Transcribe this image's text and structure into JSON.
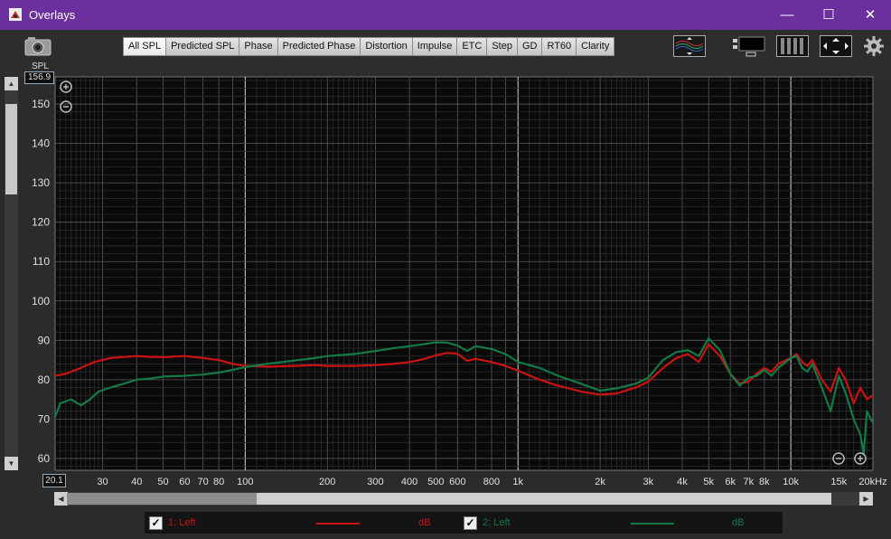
{
  "window": {
    "title": "Overlays",
    "minimize": "—",
    "maximize": "☐",
    "close": "✕"
  },
  "toolbar": {
    "camera_label": "SPL",
    "tabs": [
      "All SPL",
      "Predicted SPL",
      "Phase",
      "Predicted Phase",
      "Distortion",
      "Impulse",
      "ETC",
      "Step",
      "GD",
      "RT60",
      "Clarity"
    ],
    "active_tab": "All SPL"
  },
  "axis": {
    "ymax_box": "156.9",
    "xmin_box": "20.1"
  },
  "legend": [
    {
      "checked": "✓",
      "label": "1: Left",
      "unit": "dB",
      "color": "#cc1111"
    },
    {
      "checked": "✓",
      "label": "2: Left",
      "unit": "dB",
      "color": "#127a45"
    }
  ],
  "chart_data": {
    "type": "line",
    "xscale": "log",
    "xlim": [
      20.1,
      20000
    ],
    "ylim": [
      57,
      156.9
    ],
    "grid": true,
    "ytick_labels": [
      "60",
      "70",
      "80",
      "90",
      "100",
      "110",
      "120",
      "130",
      "140",
      "150"
    ],
    "xtick_labels": [
      {
        "f": 30,
        "label": "30"
      },
      {
        "f": 40,
        "label": "40"
      },
      {
        "f": 50,
        "label": "50"
      },
      {
        "f": 60,
        "label": "60"
      },
      {
        "f": 70,
        "label": "70"
      },
      {
        "f": 80,
        "label": "80"
      },
      {
        "f": 100,
        "label": "100"
      },
      {
        "f": 200,
        "label": "200"
      },
      {
        "f": 300,
        "label": "300"
      },
      {
        "f": 400,
        "label": "400"
      },
      {
        "f": 500,
        "label": "500"
      },
      {
        "f": 600,
        "label": "600"
      },
      {
        "f": 800,
        "label": "800"
      },
      {
        "f": 1000,
        "label": "1k"
      },
      {
        "f": 2000,
        "label": "2k"
      },
      {
        "f": 3000,
        "label": "3k"
      },
      {
        "f": 4000,
        "label": "4k"
      },
      {
        "f": 5000,
        "label": "5k"
      },
      {
        "f": 6000,
        "label": "6k"
      },
      {
        "f": 7000,
        "label": "7k"
      },
      {
        "f": 8000,
        "label": "8k"
      },
      {
        "f": 10000,
        "label": "10k"
      },
      {
        "f": 15000,
        "label": "15k"
      },
      {
        "f": 20000,
        "label": "20kHz"
      }
    ],
    "series": [
      {
        "name": "1: Left",
        "color": "#cc1111",
        "points": [
          [
            20.1,
            81
          ],
          [
            22,
            81.5
          ],
          [
            25,
            83
          ],
          [
            28,
            84.5
          ],
          [
            32,
            85.5
          ],
          [
            36,
            85.8
          ],
          [
            40,
            86
          ],
          [
            45,
            85.8
          ],
          [
            50,
            85.7
          ],
          [
            55,
            85.9
          ],
          [
            60,
            86
          ],
          [
            70,
            85.5
          ],
          [
            80,
            85
          ],
          [
            90,
            84
          ],
          [
            100,
            83.5
          ],
          [
            120,
            83.3
          ],
          [
            150,
            83.5
          ],
          [
            180,
            83.7
          ],
          [
            200,
            83.5
          ],
          [
            250,
            83.5
          ],
          [
            300,
            83.7
          ],
          [
            350,
            84
          ],
          [
            400,
            84.5
          ],
          [
            450,
            85.2
          ],
          [
            500,
            86.2
          ],
          [
            550,
            86.8
          ],
          [
            600,
            86.6
          ],
          [
            650,
            84.8
          ],
          [
            700,
            85.3
          ],
          [
            800,
            84.5
          ],
          [
            900,
            83.5
          ],
          [
            1000,
            82.3
          ],
          [
            1200,
            80
          ],
          [
            1400,
            78.5
          ],
          [
            1700,
            77
          ],
          [
            2000,
            76.2
          ],
          [
            2300,
            76.5
          ],
          [
            2700,
            78
          ],
          [
            3000,
            79.5
          ],
          [
            3400,
            83
          ],
          [
            3800,
            85.5
          ],
          [
            4200,
            86.5
          ],
          [
            4600,
            84.5
          ],
          [
            5000,
            89
          ],
          [
            5500,
            86
          ],
          [
            6000,
            81.5
          ],
          [
            6500,
            79
          ],
          [
            7000,
            79.5
          ],
          [
            7500,
            81.5
          ],
          [
            8000,
            83
          ],
          [
            8500,
            82
          ],
          [
            9000,
            84
          ],
          [
            10000,
            85.5
          ],
          [
            10500,
            86.5
          ],
          [
            11000,
            84.5
          ],
          [
            11500,
            83.5
          ],
          [
            12000,
            85
          ],
          [
            13000,
            80
          ],
          [
            14000,
            77
          ],
          [
            15000,
            83
          ],
          [
            16000,
            79.5
          ],
          [
            17000,
            74
          ],
          [
            18000,
            78
          ],
          [
            19000,
            75
          ],
          [
            20000,
            76
          ]
        ]
      },
      {
        "name": "2: Left",
        "color": "#127a45",
        "points": [
          [
            20.1,
            70.5
          ],
          [
            21,
            74
          ],
          [
            23,
            75
          ],
          [
            25,
            73.5
          ],
          [
            27,
            75
          ],
          [
            29,
            77
          ],
          [
            32,
            78
          ],
          [
            36,
            79
          ],
          [
            40,
            80
          ],
          [
            45,
            80.3
          ],
          [
            50,
            80.8
          ],
          [
            60,
            81
          ],
          [
            70,
            81.3
          ],
          [
            80,
            81.8
          ],
          [
            90,
            82.5
          ],
          [
            100,
            83.2
          ],
          [
            120,
            84
          ],
          [
            150,
            84.8
          ],
          [
            180,
            85.5
          ],
          [
            200,
            86
          ],
          [
            250,
            86.5
          ],
          [
            300,
            87.3
          ],
          [
            350,
            88
          ],
          [
            400,
            88.5
          ],
          [
            450,
            89
          ],
          [
            500,
            89.5
          ],
          [
            550,
            89.4
          ],
          [
            600,
            88.7
          ],
          [
            650,
            87.3
          ],
          [
            700,
            88.5
          ],
          [
            800,
            87.8
          ],
          [
            900,
            86.5
          ],
          [
            1000,
            84.5
          ],
          [
            1200,
            83
          ],
          [
            1400,
            81
          ],
          [
            1700,
            79
          ],
          [
            2000,
            77.2
          ],
          [
            2300,
            77.8
          ],
          [
            2700,
            79
          ],
          [
            3000,
            80.5
          ],
          [
            3400,
            85
          ],
          [
            3800,
            87
          ],
          [
            4200,
            87.5
          ],
          [
            4600,
            86
          ],
          [
            5000,
            90.5
          ],
          [
            5500,
            87.5
          ],
          [
            6000,
            81.5
          ],
          [
            6500,
            78.5
          ],
          [
            7000,
            80.5
          ],
          [
            7500,
            81
          ],
          [
            8000,
            82.5
          ],
          [
            8500,
            81
          ],
          [
            9000,
            83
          ],
          [
            10000,
            85.5
          ],
          [
            10500,
            86
          ],
          [
            11000,
            83
          ],
          [
            11500,
            82
          ],
          [
            12000,
            84
          ],
          [
            13000,
            78
          ],
          [
            14000,
            72
          ],
          [
            15000,
            81
          ],
          [
            16000,
            76
          ],
          [
            17000,
            70
          ],
          [
            18000,
            66
          ],
          [
            18500,
            61
          ],
          [
            19000,
            72
          ],
          [
            20000,
            69
          ]
        ]
      }
    ]
  }
}
